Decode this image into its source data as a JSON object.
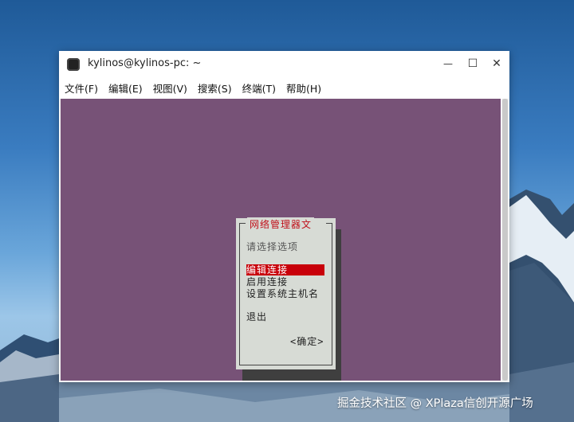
{
  "window": {
    "title": "kylinos@kylinos-pc: ~",
    "controls": {
      "minimize": "—",
      "maximize": "☐",
      "close": "✕"
    }
  },
  "menubar": {
    "items": [
      "文件(F)",
      "编辑(E)",
      "视图(V)",
      "搜索(S)",
      "终端(T)",
      "帮助(H)"
    ]
  },
  "dialog": {
    "title": "网络管理器文",
    "prompt": "请选择选项",
    "options": [
      "编辑连接",
      "启用连接",
      "设置系统主机名",
      "退出"
    ],
    "selected_option": "编辑连接",
    "ok_button": "<确定>"
  },
  "watermark": "掘金技术社区 @ XPlaza信创开源广场",
  "colors": {
    "terminal_bg": "#775277",
    "dialog_bg": "#d7dbd5",
    "selection": "#c8000a",
    "dialog_title": "#c0101a"
  }
}
